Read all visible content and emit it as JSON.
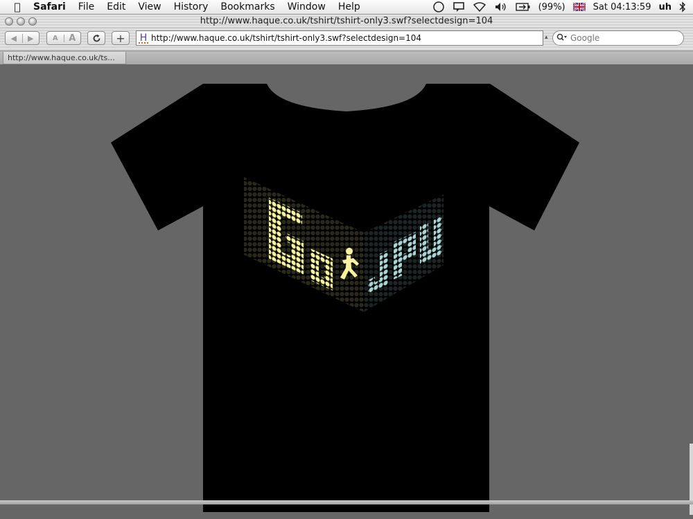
{
  "menubar": {
    "app_name": "Safari",
    "menus": [
      "File",
      "Edit",
      "View",
      "History",
      "Bookmarks",
      "Window",
      "Help"
    ],
    "battery": "(99%)",
    "clock": "Sat 04:13:59",
    "user": "uh"
  },
  "window": {
    "title": "http://www.haque.co.uk/tshirt/tshirt-only3.swf?selectdesign=104"
  },
  "toolbar": {
    "back_label": "◀",
    "forward_label": "▶",
    "text_smaller_label": "A",
    "text_bigger_label": "A",
    "reload_label": "C",
    "add_bookmark_label": "+",
    "favicon_letter": "H",
    "address_value": "http://www.haque.co.uk/tshirt/tshirt-only3.swf?selectdesign=104",
    "search_placeholder": "Google"
  },
  "tabs": [
    {
      "label": "http://www.haque.co.uk/ts..."
    }
  ],
  "design": {
    "left_text": "GO",
    "right_text": "JPN",
    "left_color": "#f7f3a0",
    "right_color": "#a9d6d4",
    "shirt_color": "#000000",
    "background_color": "#666666"
  }
}
